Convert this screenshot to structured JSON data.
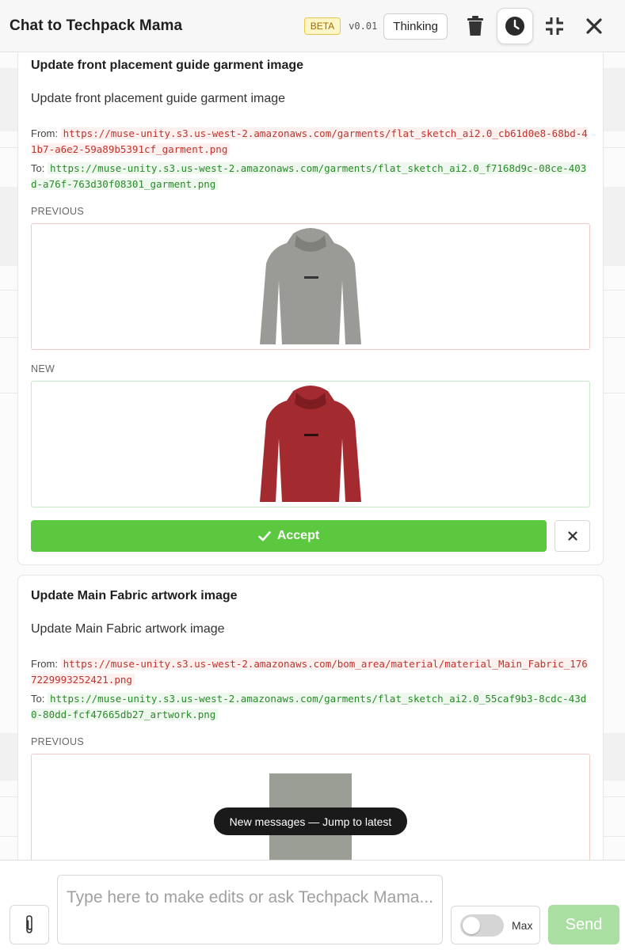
{
  "header": {
    "title": "Chat to Techpack Mama",
    "beta_badge": "BETA",
    "version": "v0.01",
    "thinking_label": "Thinking",
    "icons": [
      "trash-icon",
      "history-clock-icon",
      "minimize-icon",
      "close-icon"
    ]
  },
  "cards": [
    {
      "title": "Update front placement guide garment image",
      "description": "Update front placement guide garment image",
      "from_label": "From:",
      "from_url": "https://muse-unity.s3.us-west-2.amazonaws.com/garments/flat_sketch_ai2.0_cb61d0e8-68bd-41b7-a6e2-59a89b5391cf_garment.png",
      "to_label": "To:",
      "to_url": "https://muse-unity.s3.us-west-2.amazonaws.com/garments/flat_sketch_ai2.0_f7168d9c-08ce-403d-a76f-763d30f08301_garment.png",
      "previous_label": "PREVIOUS",
      "new_label": "NEW",
      "previous_color": "#9a9b96",
      "new_color": "#a32a2e",
      "accept_label": "Accept"
    },
    {
      "title": "Update Main Fabric artwork image",
      "description": "Update Main Fabric artwork image",
      "from_label": "From:",
      "from_url": "https://muse-unity.s3.us-west-2.amazonaws.com/bom_area/material/material_Main_Fabric_1767229993252421.png",
      "to_label": "To:",
      "to_url": "https://muse-unity.s3.us-west-2.amazonaws.com/garments/flat_sketch_ai2.0_55caf9b3-8cdc-43d0-80dd-fcf47665db27_artwork.png",
      "previous_label": "PREVIOUS",
      "previous_color": "#9a9d93"
    }
  ],
  "toast": "New messages — Jump to latest",
  "composer": {
    "placeholder": "Type here to make edits or ask Techpack Mama...",
    "max_label": "Max",
    "max_enabled": false,
    "send_label": "Send"
  },
  "colors": {
    "accept": "#5cc840",
    "send_disabled": "#a9dfa0",
    "from_code": "#c0332d",
    "to_code": "#2a8a2a"
  }
}
